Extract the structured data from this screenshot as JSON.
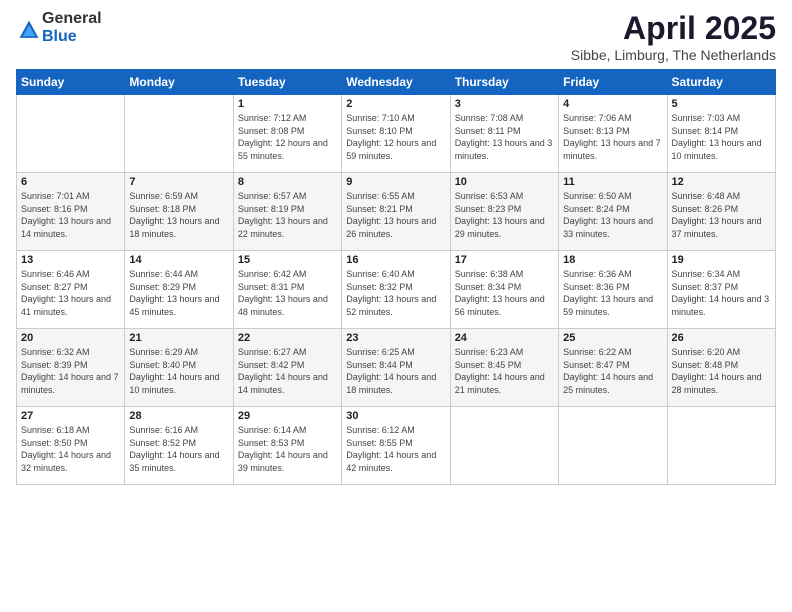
{
  "header": {
    "logo": {
      "general": "General",
      "blue": "Blue"
    },
    "title": "April 2025",
    "subtitle": "Sibbe, Limburg, The Netherlands"
  },
  "days_of_week": [
    "Sunday",
    "Monday",
    "Tuesday",
    "Wednesday",
    "Thursday",
    "Friday",
    "Saturday"
  ],
  "weeks": [
    [
      {
        "day": "",
        "info": ""
      },
      {
        "day": "",
        "info": ""
      },
      {
        "day": "1",
        "info": "Sunrise: 7:12 AM\nSunset: 8:08 PM\nDaylight: 12 hours and 55 minutes."
      },
      {
        "day": "2",
        "info": "Sunrise: 7:10 AM\nSunset: 8:10 PM\nDaylight: 12 hours and 59 minutes."
      },
      {
        "day": "3",
        "info": "Sunrise: 7:08 AM\nSunset: 8:11 PM\nDaylight: 13 hours and 3 minutes."
      },
      {
        "day": "4",
        "info": "Sunrise: 7:06 AM\nSunset: 8:13 PM\nDaylight: 13 hours and 7 minutes."
      },
      {
        "day": "5",
        "info": "Sunrise: 7:03 AM\nSunset: 8:14 PM\nDaylight: 13 hours and 10 minutes."
      }
    ],
    [
      {
        "day": "6",
        "info": "Sunrise: 7:01 AM\nSunset: 8:16 PM\nDaylight: 13 hours and 14 minutes."
      },
      {
        "day": "7",
        "info": "Sunrise: 6:59 AM\nSunset: 8:18 PM\nDaylight: 13 hours and 18 minutes."
      },
      {
        "day": "8",
        "info": "Sunrise: 6:57 AM\nSunset: 8:19 PM\nDaylight: 13 hours and 22 minutes."
      },
      {
        "day": "9",
        "info": "Sunrise: 6:55 AM\nSunset: 8:21 PM\nDaylight: 13 hours and 26 minutes."
      },
      {
        "day": "10",
        "info": "Sunrise: 6:53 AM\nSunset: 8:23 PM\nDaylight: 13 hours and 29 minutes."
      },
      {
        "day": "11",
        "info": "Sunrise: 6:50 AM\nSunset: 8:24 PM\nDaylight: 13 hours and 33 minutes."
      },
      {
        "day": "12",
        "info": "Sunrise: 6:48 AM\nSunset: 8:26 PM\nDaylight: 13 hours and 37 minutes."
      }
    ],
    [
      {
        "day": "13",
        "info": "Sunrise: 6:46 AM\nSunset: 8:27 PM\nDaylight: 13 hours and 41 minutes."
      },
      {
        "day": "14",
        "info": "Sunrise: 6:44 AM\nSunset: 8:29 PM\nDaylight: 13 hours and 45 minutes."
      },
      {
        "day": "15",
        "info": "Sunrise: 6:42 AM\nSunset: 8:31 PM\nDaylight: 13 hours and 48 minutes."
      },
      {
        "day": "16",
        "info": "Sunrise: 6:40 AM\nSunset: 8:32 PM\nDaylight: 13 hours and 52 minutes."
      },
      {
        "day": "17",
        "info": "Sunrise: 6:38 AM\nSunset: 8:34 PM\nDaylight: 13 hours and 56 minutes."
      },
      {
        "day": "18",
        "info": "Sunrise: 6:36 AM\nSunset: 8:36 PM\nDaylight: 13 hours and 59 minutes."
      },
      {
        "day": "19",
        "info": "Sunrise: 6:34 AM\nSunset: 8:37 PM\nDaylight: 14 hours and 3 minutes."
      }
    ],
    [
      {
        "day": "20",
        "info": "Sunrise: 6:32 AM\nSunset: 8:39 PM\nDaylight: 14 hours and 7 minutes."
      },
      {
        "day": "21",
        "info": "Sunrise: 6:29 AM\nSunset: 8:40 PM\nDaylight: 14 hours and 10 minutes."
      },
      {
        "day": "22",
        "info": "Sunrise: 6:27 AM\nSunset: 8:42 PM\nDaylight: 14 hours and 14 minutes."
      },
      {
        "day": "23",
        "info": "Sunrise: 6:25 AM\nSunset: 8:44 PM\nDaylight: 14 hours and 18 minutes."
      },
      {
        "day": "24",
        "info": "Sunrise: 6:23 AM\nSunset: 8:45 PM\nDaylight: 14 hours and 21 minutes."
      },
      {
        "day": "25",
        "info": "Sunrise: 6:22 AM\nSunset: 8:47 PM\nDaylight: 14 hours and 25 minutes."
      },
      {
        "day": "26",
        "info": "Sunrise: 6:20 AM\nSunset: 8:48 PM\nDaylight: 14 hours and 28 minutes."
      }
    ],
    [
      {
        "day": "27",
        "info": "Sunrise: 6:18 AM\nSunset: 8:50 PM\nDaylight: 14 hours and 32 minutes."
      },
      {
        "day": "28",
        "info": "Sunrise: 6:16 AM\nSunset: 8:52 PM\nDaylight: 14 hours and 35 minutes."
      },
      {
        "day": "29",
        "info": "Sunrise: 6:14 AM\nSunset: 8:53 PM\nDaylight: 14 hours and 39 minutes."
      },
      {
        "day": "30",
        "info": "Sunrise: 6:12 AM\nSunset: 8:55 PM\nDaylight: 14 hours and 42 minutes."
      },
      {
        "day": "",
        "info": ""
      },
      {
        "day": "",
        "info": ""
      },
      {
        "day": "",
        "info": ""
      }
    ]
  ]
}
